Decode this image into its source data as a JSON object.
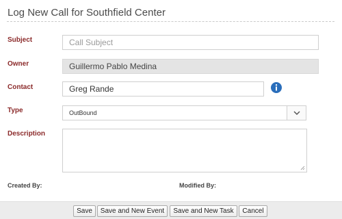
{
  "title": "Log New Call for Southfield Center",
  "form": {
    "subject": {
      "label": "Subject",
      "placeholder": "Call Subject",
      "value": ""
    },
    "owner": {
      "label": "Owner",
      "value": "Guillermo Pablo Medina"
    },
    "contact": {
      "label": "Contact",
      "value": "Greg Rande",
      "icon": "info-icon"
    },
    "type": {
      "label": "Type",
      "value": "OutBound",
      "icon": "chevron-down-icon"
    },
    "description": {
      "label": "Description",
      "value": ""
    },
    "created_by": {
      "label": "Created By:",
      "value": ""
    },
    "modified_by": {
      "label": "Modified By:",
      "value": ""
    }
  },
  "buttons": {
    "save": "Save",
    "save_new_event": "Save and New Event",
    "save_new_task": "Save and New Task",
    "cancel": "Cancel"
  },
  "colors": {
    "label": "#8b2a2a",
    "info_icon": "#2a6ebb",
    "readonly_bg": "#e4e4e4"
  }
}
